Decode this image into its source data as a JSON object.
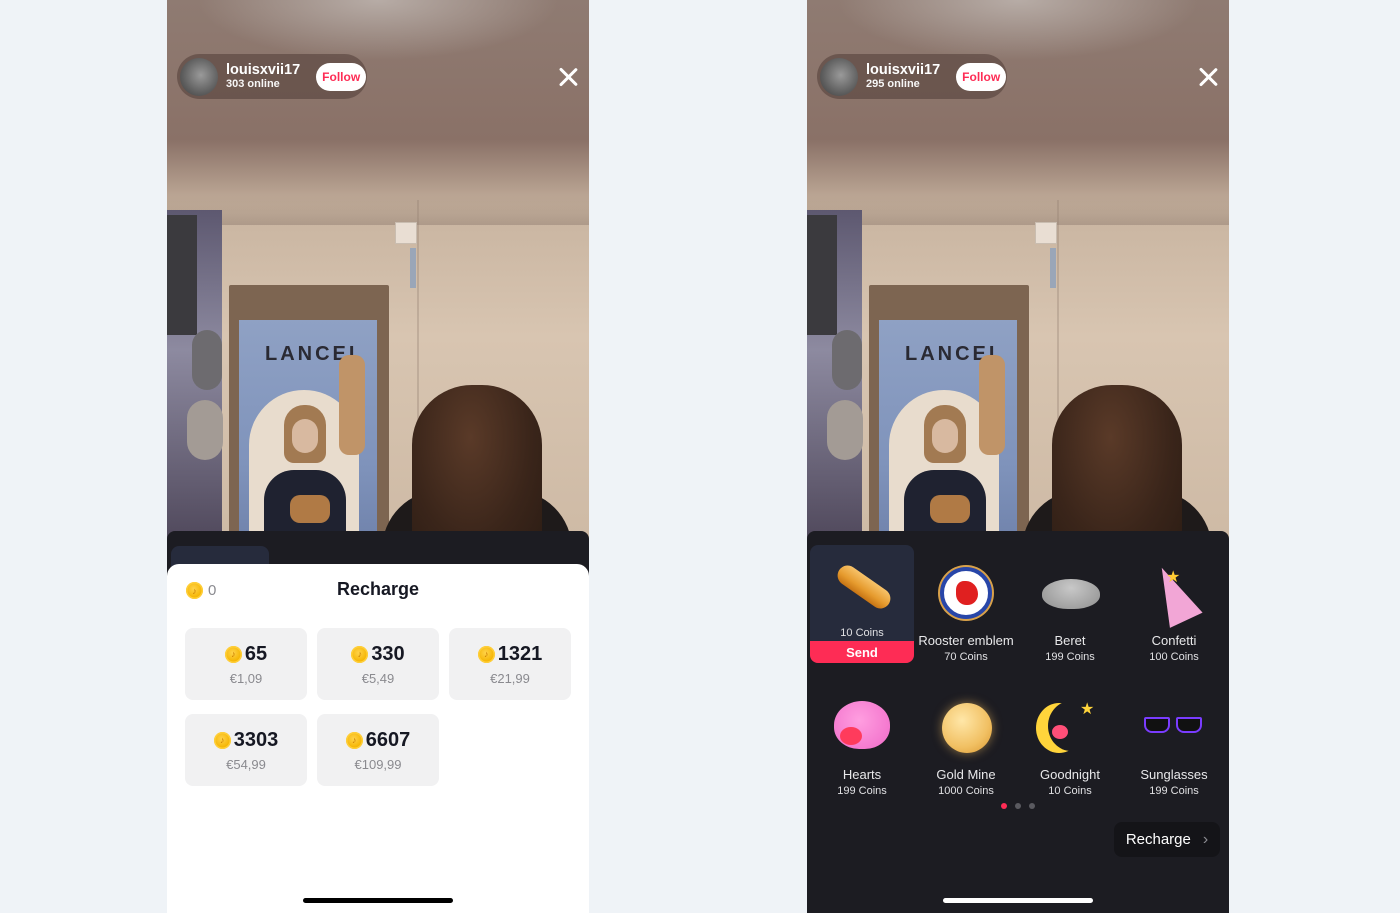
{
  "left_screen": {
    "host": {
      "username": "louisxvii17",
      "online": "303 online",
      "follow_label": "Follow"
    },
    "recharge_sheet": {
      "title": "Recharge",
      "balance": "0",
      "packages": [
        {
          "coins": "65",
          "price": "€1,09"
        },
        {
          "coins": "330",
          "price": "€5,49"
        },
        {
          "coins": "1321",
          "price": "€21,99"
        },
        {
          "coins": "3303",
          "price": "€54,99"
        },
        {
          "coins": "6607",
          "price": "€109,99"
        }
      ]
    }
  },
  "right_screen": {
    "host": {
      "username": "louisxvii17",
      "online": "295 online",
      "follow_label": "Follow"
    },
    "gift_panel": {
      "gifts": [
        {
          "name": "Baguette",
          "price": "10 Coins",
          "icon": "baguette-icon",
          "selected": true
        },
        {
          "name": "Rooster emblem",
          "price": "70 Coins",
          "icon": "rooster-emblem-icon"
        },
        {
          "name": "Beret",
          "price": "199 Coins",
          "icon": "beret-icon"
        },
        {
          "name": "Confetti",
          "price": "100 Coins",
          "icon": "confetti-icon"
        },
        {
          "name": "Hearts",
          "price": "199 Coins",
          "icon": "hearts-icon"
        },
        {
          "name": "Gold Mine",
          "price": "1000 Coins",
          "icon": "gold-mine-icon"
        },
        {
          "name": "Goodnight",
          "price": "10 Coins",
          "icon": "goodnight-icon"
        },
        {
          "name": "Sunglasses",
          "price": "199 Coins",
          "icon": "sunglasses-icon"
        }
      ],
      "send_label": "Send",
      "page_count": 3,
      "active_page": 1,
      "recharge_label": "Recharge",
      "recharge_chevron": "›"
    }
  },
  "colors": {
    "accent": "#fe2c55",
    "panel_dark": "#1c1c22",
    "selected_gift_bg": "#262b3c",
    "coin_gold": "#f5b400"
  },
  "video_scene_text": "LANCEL"
}
